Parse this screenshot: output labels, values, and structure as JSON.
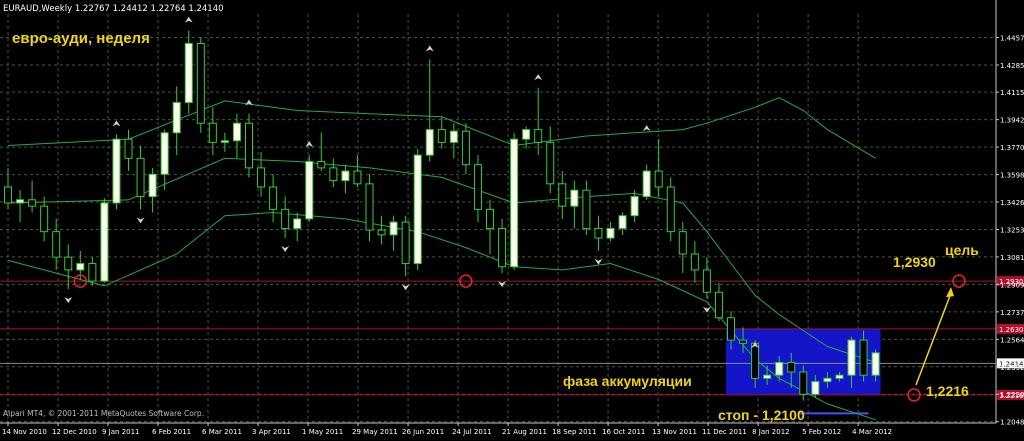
{
  "window": {
    "header_text": "EURAUD,Weekly  1.22767 1.24412 1.22764 1.24140",
    "footer_text": "Alpari MT4, © 2001-2011 MetaQuotes Software Corp."
  },
  "chart_data": {
    "type": "candlestick",
    "symbol": "EURAUD",
    "timeframe": "Weekly",
    "ohlc_header": [
      1.22767,
      1.24412,
      1.22764,
      1.2414
    ],
    "ylim": [
      1.204,
      1.4605
    ],
    "y_ticks": [
      "1.44575",
      "1.42850",
      "1.41150",
      "1.39425",
      "1.37705",
      "1.35980",
      "1.34260",
      "1.32535",
      "1.30815",
      "1.29090",
      "1.27370",
      "1.25645",
      "1.23925",
      "1.22205",
      "1.20485"
    ],
    "y_tick_values": [
      1.44575,
      1.4285,
      1.4115,
      1.39425,
      1.37705,
      1.3598,
      1.3426,
      1.32535,
      1.30815,
      1.2909,
      1.2737,
      1.25645,
      1.23925,
      1.22205,
      1.20485
    ],
    "x_ticks": [
      "14 Nov 2010",
      "12 Dec 2010",
      "9 Jan 2011",
      "6 Feb 2011",
      "6 Mar 2011",
      "3 Apr 2011",
      "1 May 2011",
      "29 May 2011",
      "26 Jun 2011",
      "24 Jul 2011",
      "21 Aug 2011",
      "18 Sep 2011",
      "16 Oct 2011",
      "13 Nov 2011",
      "11 Dec 2011",
      "8 Jan 2012",
      "5 Feb 2012",
      "4 Mar 2012"
    ],
    "candles": [
      {
        "o": 1.352,
        "h": 1.364,
        "l": 1.338,
        "c": 1.342
      },
      {
        "o": 1.342,
        "h": 1.35,
        "l": 1.33,
        "c": 1.344
      },
      {
        "o": 1.344,
        "h": 1.356,
        "l": 1.336,
        "c": 1.34
      },
      {
        "o": 1.34,
        "h": 1.346,
        "l": 1.318,
        "c": 1.324
      },
      {
        "o": 1.324,
        "h": 1.332,
        "l": 1.3,
        "c": 1.308
      },
      {
        "o": 1.308,
        "h": 1.316,
        "l": 1.288,
        "c": 1.3
      },
      {
        "o": 1.3,
        "h": 1.312,
        "l": 1.294,
        "c": 1.304
      },
      {
        "o": 1.304,
        "h": 1.308,
        "l": 1.29,
        "c": 1.293
      },
      {
        "o": 1.293,
        "h": 1.345,
        "l": 1.292,
        "c": 1.342
      },
      {
        "o": 1.342,
        "h": 1.385,
        "l": 1.338,
        "c": 1.382
      },
      {
        "o": 1.382,
        "h": 1.388,
        "l": 1.362,
        "c": 1.37
      },
      {
        "o": 1.37,
        "h": 1.378,
        "l": 1.338,
        "c": 1.346
      },
      {
        "o": 1.346,
        "h": 1.364,
        "l": 1.336,
        "c": 1.36
      },
      {
        "o": 1.36,
        "h": 1.388,
        "l": 1.35,
        "c": 1.386
      },
      {
        "o": 1.386,
        "h": 1.415,
        "l": 1.372,
        "c": 1.405
      },
      {
        "o": 1.405,
        "h": 1.45,
        "l": 1.398,
        "c": 1.442
      },
      {
        "o": 1.442,
        "h": 1.446,
        "l": 1.386,
        "c": 1.392
      },
      {
        "o": 1.392,
        "h": 1.402,
        "l": 1.372,
        "c": 1.38
      },
      {
        "o": 1.38,
        "h": 1.386,
        "l": 1.374,
        "c": 1.381
      },
      {
        "o": 1.381,
        "h": 1.398,
        "l": 1.37,
        "c": 1.392
      },
      {
        "o": 1.392,
        "h": 1.398,
        "l": 1.358,
        "c": 1.364
      },
      {
        "o": 1.364,
        "h": 1.374,
        "l": 1.346,
        "c": 1.352
      },
      {
        "o": 1.352,
        "h": 1.36,
        "l": 1.33,
        "c": 1.338
      },
      {
        "o": 1.338,
        "h": 1.346,
        "l": 1.32,
        "c": 1.326
      },
      {
        "o": 1.326,
        "h": 1.336,
        "l": 1.318,
        "c": 1.332
      },
      {
        "o": 1.332,
        "h": 1.372,
        "l": 1.33,
        "c": 1.368
      },
      {
        "o": 1.368,
        "h": 1.386,
        "l": 1.362,
        "c": 1.364
      },
      {
        "o": 1.364,
        "h": 1.37,
        "l": 1.352,
        "c": 1.356
      },
      {
        "o": 1.356,
        "h": 1.366,
        "l": 1.348,
        "c": 1.362
      },
      {
        "o": 1.362,
        "h": 1.372,
        "l": 1.352,
        "c": 1.354
      },
      {
        "o": 1.354,
        "h": 1.36,
        "l": 1.318,
        "c": 1.325
      },
      {
        "o": 1.325,
        "h": 1.334,
        "l": 1.316,
        "c": 1.322
      },
      {
        "o": 1.322,
        "h": 1.334,
        "l": 1.312,
        "c": 1.33
      },
      {
        "o": 1.33,
        "h": 1.334,
        "l": 1.296,
        "c": 1.304
      },
      {
        "o": 1.304,
        "h": 1.376,
        "l": 1.3,
        "c": 1.372
      },
      {
        "o": 1.372,
        "h": 1.432,
        "l": 1.368,
        "c": 1.388
      },
      {
        "o": 1.388,
        "h": 1.396,
        "l": 1.376,
        "c": 1.38
      },
      {
        "o": 1.38,
        "h": 1.392,
        "l": 1.37,
        "c": 1.387
      },
      {
        "o": 1.387,
        "h": 1.392,
        "l": 1.36,
        "c": 1.366
      },
      {
        "o": 1.366,
        "h": 1.372,
        "l": 1.33,
        "c": 1.338
      },
      {
        "o": 1.338,
        "h": 1.344,
        "l": 1.31,
        "c": 1.326
      },
      {
        "o": 1.326,
        "h": 1.332,
        "l": 1.298,
        "c": 1.302
      },
      {
        "o": 1.302,
        "h": 1.386,
        "l": 1.3,
        "c": 1.382
      },
      {
        "o": 1.382,
        "h": 1.39,
        "l": 1.376,
        "c": 1.388
      },
      {
        "o": 1.388,
        "h": 1.414,
        "l": 1.372,
        "c": 1.38
      },
      {
        "o": 1.38,
        "h": 1.39,
        "l": 1.348,
        "c": 1.354
      },
      {
        "o": 1.354,
        "h": 1.362,
        "l": 1.332,
        "c": 1.34
      },
      {
        "o": 1.34,
        "h": 1.356,
        "l": 1.326,
        "c": 1.35
      },
      {
        "o": 1.35,
        "h": 1.356,
        "l": 1.322,
        "c": 1.326
      },
      {
        "o": 1.326,
        "h": 1.334,
        "l": 1.312,
        "c": 1.32
      },
      {
        "o": 1.32,
        "h": 1.33,
        "l": 1.318,
        "c": 1.326
      },
      {
        "o": 1.326,
        "h": 1.336,
        "l": 1.322,
        "c": 1.334
      },
      {
        "o": 1.334,
        "h": 1.35,
        "l": 1.33,
        "c": 1.346
      },
      {
        "o": 1.346,
        "h": 1.366,
        "l": 1.344,
        "c": 1.362
      },
      {
        "o": 1.362,
        "h": 1.382,
        "l": 1.346,
        "c": 1.352
      },
      {
        "o": 1.352,
        "h": 1.358,
        "l": 1.318,
        "c": 1.324
      },
      {
        "o": 1.324,
        "h": 1.33,
        "l": 1.298,
        "c": 1.31
      },
      {
        "o": 1.31,
        "h": 1.318,
        "l": 1.292,
        "c": 1.3
      },
      {
        "o": 1.3,
        "h": 1.308,
        "l": 1.282,
        "c": 1.286
      },
      {
        "o": 1.286,
        "h": 1.292,
        "l": 1.268,
        "c": 1.27
      },
      {
        "o": 1.27,
        "h": 1.274,
        "l": 1.25,
        "c": 1.256
      },
      {
        "o": 1.256,
        "h": 1.264,
        "l": 1.248,
        "c": 1.254
      },
      {
        "o": 1.254,
        "h": 1.256,
        "l": 1.226,
        "c": 1.232
      },
      {
        "o": 1.232,
        "h": 1.24,
        "l": 1.228,
        "c": 1.234
      },
      {
        "o": 1.234,
        "h": 1.246,
        "l": 1.23,
        "c": 1.242
      },
      {
        "o": 1.242,
        "h": 1.248,
        "l": 1.226,
        "c": 1.236
      },
      {
        "o": 1.236,
        "h": 1.24,
        "l": 1.218,
        "c": 1.222
      },
      {
        "o": 1.222,
        "h": 1.234,
        "l": 1.22,
        "c": 1.23
      },
      {
        "o": 1.23,
        "h": 1.236,
        "l": 1.226,
        "c": 1.232
      },
      {
        "o": 1.232,
        "h": 1.236,
        "l": 1.23,
        "c": 1.234
      },
      {
        "o": 1.234,
        "h": 1.258,
        "l": 1.226,
        "c": 1.256
      },
      {
        "o": 1.256,
        "h": 1.262,
        "l": 1.23,
        "c": 1.234
      },
      {
        "o": 1.234,
        "h": 1.25,
        "l": 1.23,
        "c": 1.248
      }
    ],
    "envelopes": {
      "upper": [
        [
          0,
          1.378
        ],
        [
          10,
          1.382
        ],
        [
          18,
          1.406
        ],
        [
          24,
          1.4
        ],
        [
          30,
          1.398
        ],
        [
          36,
          1.396
        ],
        [
          42,
          1.378
        ],
        [
          48,
          1.384
        ],
        [
          52,
          1.386
        ],
        [
          56,
          1.388
        ],
        [
          58,
          1.392
        ],
        [
          62,
          1.402
        ],
        [
          64,
          1.408
        ],
        [
          66,
          1.4
        ],
        [
          68,
          1.388
        ],
        [
          72,
          1.37
        ]
      ],
      "middle": [
        [
          0,
          1.342
        ],
        [
          10,
          1.344
        ],
        [
          18,
          1.37
        ],
        [
          24,
          1.368
        ],
        [
          30,
          1.364
        ],
        [
          36,
          1.358
        ],
        [
          42,
          1.342
        ],
        [
          48,
          1.346
        ],
        [
          52,
          1.348
        ],
        [
          56,
          1.342
        ],
        [
          58,
          1.324
        ],
        [
          60,
          1.304
        ],
        [
          62,
          1.284
        ],
        [
          64,
          1.272
        ],
        [
          66,
          1.262
        ],
        [
          68,
          1.252
        ],
        [
          72,
          1.242
        ]
      ],
      "lower": [
        [
          0,
          1.306
        ],
        [
          8,
          1.29
        ],
        [
          14,
          1.31
        ],
        [
          18,
          1.334
        ],
        [
          22,
          1.336
        ],
        [
          28,
          1.332
        ],
        [
          34,
          1.324
        ],
        [
          38,
          1.314
        ],
        [
          42,
          1.302
        ],
        [
          46,
          1.3
        ],
        [
          50,
          1.304
        ],
        [
          54,
          1.294
        ],
        [
          58,
          1.28
        ],
        [
          60,
          1.262
        ],
        [
          62,
          1.244
        ],
        [
          64,
          1.232
        ],
        [
          66,
          1.224
        ],
        [
          68,
          1.216
        ],
        [
          72,
          1.206
        ]
      ]
    },
    "fractals_up": [
      [
        15,
        1.45
      ],
      [
        9,
        1.385
      ],
      [
        20,
        1.398
      ],
      [
        25,
        1.372
      ],
      [
        35,
        1.432
      ],
      [
        44,
        1.414
      ],
      [
        53,
        1.382
      ],
      [
        62,
        1.246
      ]
    ],
    "fractals_down": [
      [
        5,
        1.288
      ],
      [
        11,
        1.338
      ],
      [
        23,
        1.32
      ],
      [
        33,
        1.296
      ],
      [
        41,
        1.298
      ],
      [
        49,
        1.312
      ],
      [
        58,
        1.282
      ]
    ],
    "levels": [
      {
        "value": 1.293,
        "tag": "1.29300"
      },
      {
        "value": 1.263,
        "tag": "1.26300"
      },
      {
        "value": 1.2216,
        "tag": "1.22160"
      }
    ],
    "current_price": {
      "value": 1.2414,
      "tag": "1.24140"
    },
    "accumulation_box": {
      "x_from": 60,
      "x_to": 72,
      "y_from": 1.2216,
      "y_to": 1.263
    },
    "annotations": {
      "title": "евро-ауди, неделя",
      "accumulation": "фаза аккумуляции",
      "stop": "стоп - 1,2100",
      "target_label": "цель",
      "target_value": "1,2930",
      "support_value": "1,2216"
    },
    "colors": {
      "background": "#000000",
      "grid": "#3c5a3c",
      "candle_up": "#fffff0",
      "candle_down": "#000000",
      "candle_outline": "#33cc33",
      "envelope": "#22aa44",
      "level_line": "#b0102a",
      "box": "#1414c8",
      "annotation": "#f2d311",
      "circle": "#e8202a"
    }
  }
}
